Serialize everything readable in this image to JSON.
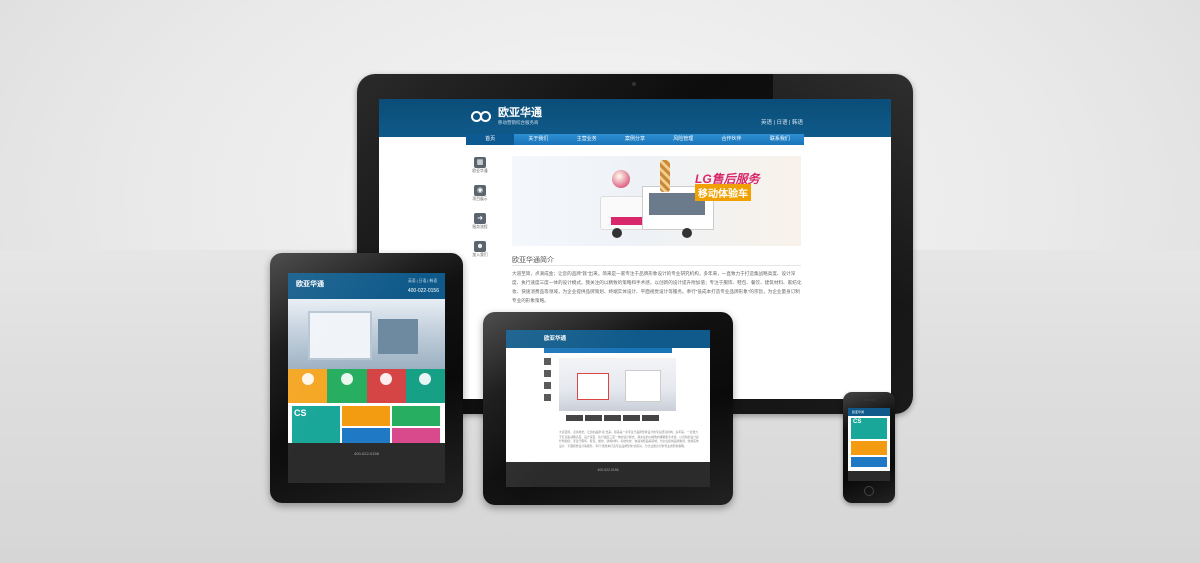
{
  "site": {
    "logo_cn": "欧亚华通",
    "logo_sub": "移动营销综合服务商",
    "languages": "英语 | 日语 | 韩语",
    "nav": [
      "首页",
      "关于我们",
      "主营业务",
      "案例分享",
      "风险管理",
      "合作伙伴",
      "联系我们"
    ],
    "side_menu": [
      "欧亚华通",
      "项目展示",
      "服务流程",
      "加入我们"
    ],
    "banner_title": "LG售后服务",
    "banner_subtitle": "移动体验车",
    "about_heading": "欧亚华通简介",
    "about_text": "大道至简，点滴成金；让您的品牌“就”出来。简来是一家专注于品牌形象设计的专业研究机构，多年来，一直致力于打造集战略高度、设计深度、执行速度三度一体的设计模式。我关注的以精致的策略和手术感，以创新的设计提升附加值；专注于服饰、鞋包、餐饮、建筑材料、家纺化妆、快速消费品等领域，为企业提供品牌策划、终端实体设计、平面视觉设计等服务。奉行“低成本打造专业品牌形象”的宗旨，为企业量身订制专业的形象策略。",
    "phone": "400-022-0156",
    "cs_tile": "CS"
  },
  "accent": {
    "primary": "#0f5a8a",
    "nav": "#1a74b8",
    "orange": "#f0a000",
    "pink": "#d8286b"
  },
  "tablet_categories": [
    {
      "color": "#f5a623"
    },
    {
      "color": "#27ae60"
    },
    {
      "color": "#d64545"
    },
    {
      "color": "#16a085"
    }
  ],
  "tablet_tiles": [
    {
      "color": "#19a79a"
    },
    {
      "color": "#f39c12"
    },
    {
      "color": "#27ae60"
    },
    {
      "color": "#1f79c4"
    },
    {
      "color": "#d94a8c"
    }
  ]
}
